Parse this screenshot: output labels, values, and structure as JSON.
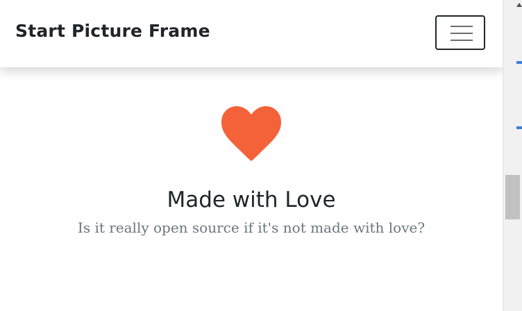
{
  "navbar": {
    "brand": "Start Picture Frame",
    "toggler_label": "Toggle navigation"
  },
  "feature": {
    "icon": "heart-icon",
    "icon_color": "#f4623a",
    "title": "Made with Love",
    "text": "Is it really open source if it's not made with love?"
  },
  "colors": {
    "heading": "#212529",
    "muted": "#6c757d",
    "accent": "#f4623a"
  }
}
